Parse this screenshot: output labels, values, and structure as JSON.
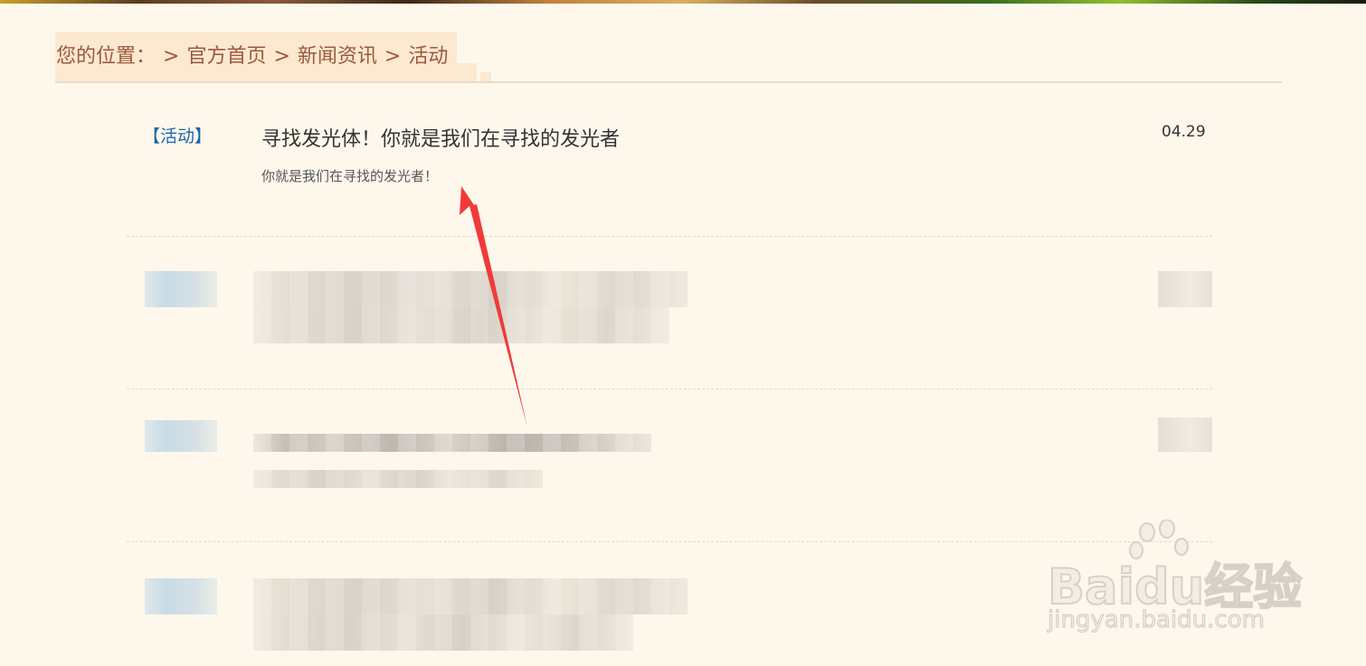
{
  "breadcrumb": {
    "label": "您的位置：",
    "sep1": ">",
    "home": "官方首页",
    "sep2": ">",
    "news": "新闻资讯",
    "sep3": ">",
    "current": "活动"
  },
  "article": {
    "tag": "【活动】",
    "title": "寻找发光体！你就是我们在寻找的发光者",
    "summary": "你就是我们在寻找的发光者！",
    "date": "04.29"
  },
  "watermark": {
    "logo": "Baidu经验",
    "url": "jingyan.baidu.com"
  },
  "colors": {
    "background": "#fef8ec",
    "breadcrumb_text": "#9a5a3c",
    "breadcrumb_bg": "#fde8d0",
    "tag": "#1e66b0",
    "arrow": "#f03a3a"
  }
}
